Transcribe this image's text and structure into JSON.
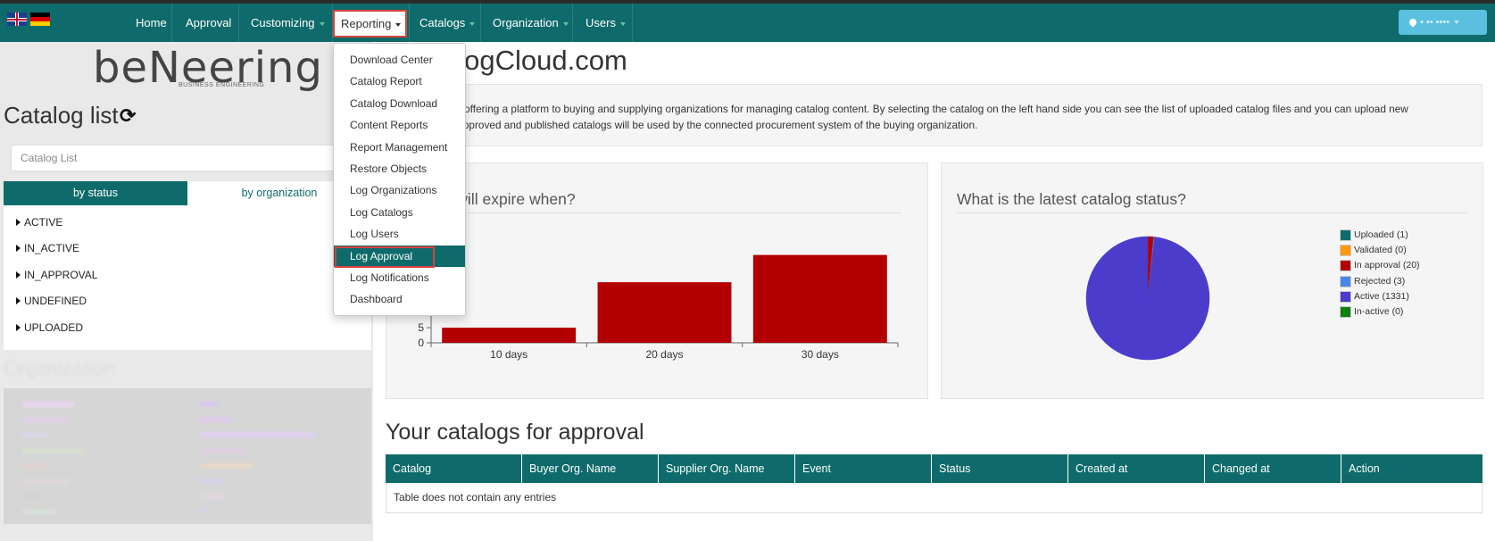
{
  "navbar": {
    "flags": [
      "uk-flag",
      "de-flag"
    ],
    "items": [
      {
        "label": "Home",
        "caret": false
      },
      {
        "label": "Approval",
        "caret": false
      },
      {
        "label": "Customizing",
        "caret": true
      },
      {
        "label": "Reporting",
        "caret": true
      },
      {
        "label": "Catalogs",
        "caret": true
      },
      {
        "label": "Organization",
        "caret": true
      },
      {
        "label": "Users",
        "caret": true
      }
    ],
    "user_label": "• •• ••••"
  },
  "sidebar": {
    "logo_text": "beNeering",
    "logo_sub": "BUSINESS ENGINEERING",
    "title": "Catalog list",
    "search_placeholder": "Catalog List",
    "tabs": {
      "status": "by status",
      "organization": "by organization"
    },
    "status_items": [
      "ACTIVE",
      "IN_ACTIVE",
      "IN_APPROVAL",
      "UNDEFINED",
      "UPLOADED"
    ],
    "org_title": "Organization"
  },
  "reporting_menu": {
    "items": [
      "Download Center",
      "Catalog Report",
      "Catalog Download",
      "Content Reports",
      "Report Management",
      "Restore Objects",
      "Log Organizations",
      "Log Catalogs",
      "Log Users",
      "Log Approval",
      "Log Notifications",
      "Dashboard"
    ],
    "active_index": 9
  },
  "main": {
    "title": "alogCloud.com",
    "intro_line1": "s offering a platform to buying and supplying organizations for managing catalog content. By selecting the catalog on the left hand side you can see the list of uploaded catalog files and you can upload new",
    "intro_line2": "Approved and published catalogs will be used by the connected procurement system of the buying organization."
  },
  "chart_data": [
    {
      "type": "bar",
      "title": "atalogs will expire when?",
      "categories": [
        "10 days",
        "20 days",
        "30 days"
      ],
      "values": [
        5,
        20,
        29
      ],
      "yticks": [
        0,
        5
      ],
      "ylim": [
        0,
        33
      ],
      "color": "#b30000"
    },
    {
      "type": "pie",
      "title": "What is the latest catalog status?",
      "legend_position": "right",
      "slices": [
        {
          "label": "Uploaded (1)",
          "value": 1,
          "color": "#0f6b6b"
        },
        {
          "label": "Validated (0)",
          "value": 0,
          "color": "#ff9900"
        },
        {
          "label": "In approval (20)",
          "value": 20,
          "color": "#b30000"
        },
        {
          "label": "Rejected (3)",
          "value": 3,
          "color": "#4a86e8"
        },
        {
          "label": "Active (1331)",
          "value": 1331,
          "color": "#4b3ccc"
        },
        {
          "label": "In-active (0)",
          "value": 0,
          "color": "#108010"
        }
      ]
    }
  ],
  "approval": {
    "title": "Your catalogs for approval",
    "columns": [
      "Catalog",
      "Buyer Org. Name",
      "Supplier Org. Name",
      "Event",
      "Status",
      "Created at",
      "Changed at",
      "Action"
    ],
    "empty_text": "Table does not contain any entries"
  },
  "colors": {
    "brand": "#0f6b6b",
    "bar": "#b30000",
    "highlight": "#d9413c",
    "user_button": "#5bc0de"
  }
}
